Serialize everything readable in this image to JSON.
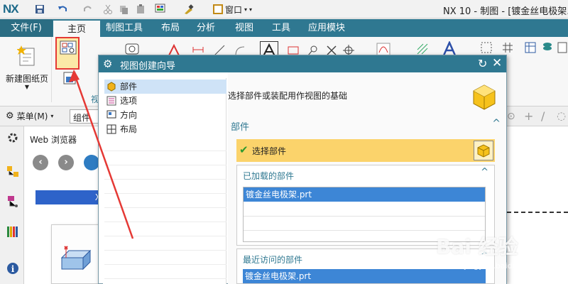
{
  "app": {
    "logo": "NX",
    "window_menu": "窗口",
    "title": "NX 10 - 制图 - [镀金丝电极架.pr"
  },
  "ribbon": {
    "file_tab": "文件(F)",
    "tabs": [
      "主页",
      "制图工具",
      "布局",
      "分析",
      "视图",
      "工具",
      "应用模块"
    ],
    "new_sheet_label": "新建图纸页",
    "group_fragment": "视"
  },
  "commandbar": {
    "menu_label": "菜单(M)",
    "group_field": "组件"
  },
  "web_panel": {
    "title": "Web 浏览器",
    "banner_fragment": "X"
  },
  "dialog": {
    "title": "视图创建向导",
    "nav_items": [
      "部件",
      "选项",
      "方向",
      "布局"
    ],
    "selected_nav": "部件",
    "prompt": "选择部件或装配用作视图的基础",
    "section_title": "部件",
    "select_part_label": "选择部件",
    "loaded_title": "已加载的部件",
    "loaded_items": [
      "镀金丝电极架.prt"
    ],
    "recent_title": "最近访问的部件",
    "recent_items": [
      "镀金丝电极架.prt"
    ]
  },
  "watermark": {
    "text": "Bai 经验",
    "url": "jingyan.baidu.com"
  },
  "colors": {
    "ribbon_teal": "#2f7891",
    "highlight_yellow": "#fbd36b",
    "selection_blue": "#3d86d6",
    "callout_red": "#e53935"
  }
}
